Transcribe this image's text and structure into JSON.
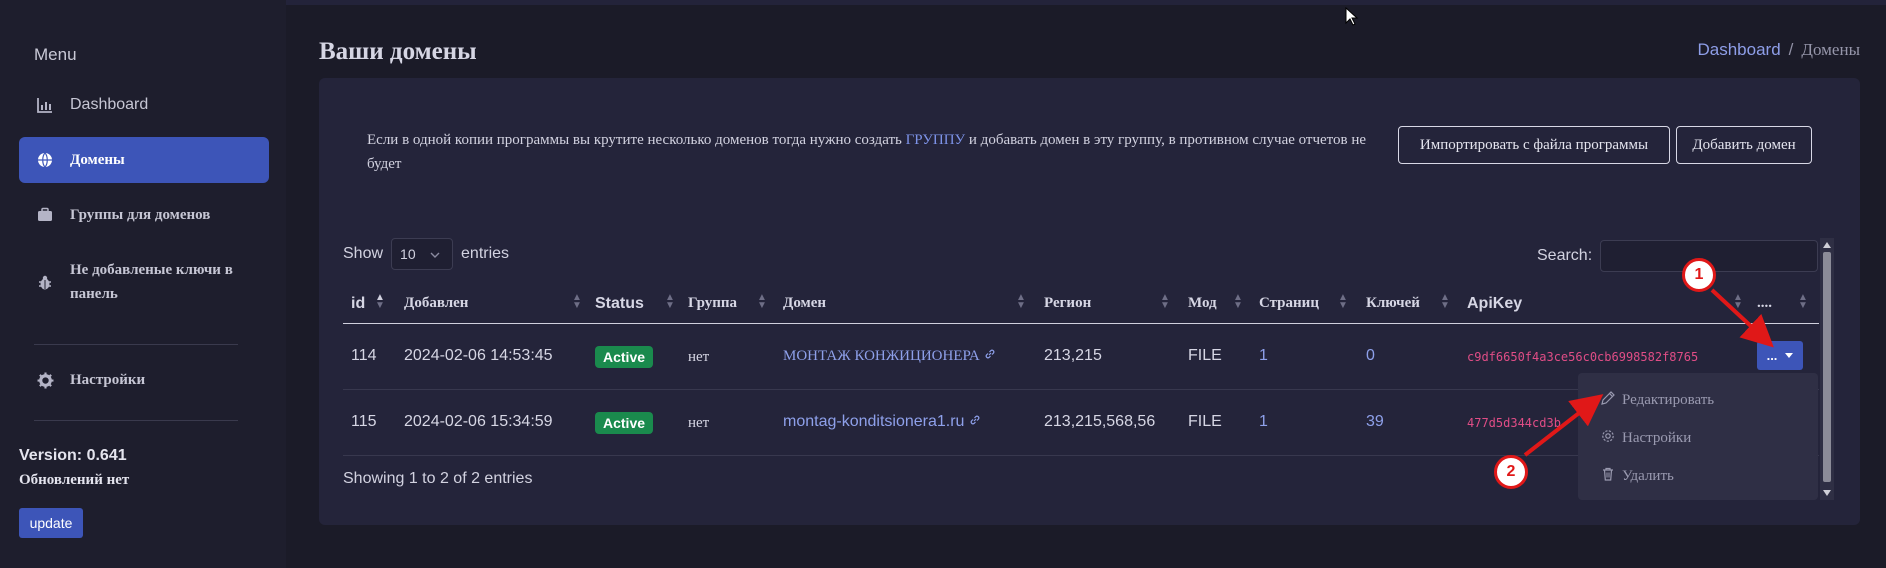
{
  "sidebar": {
    "menu_title": "Menu",
    "items": [
      {
        "label": "Dashboard",
        "icon": "chart-icon"
      },
      {
        "label": "Домены",
        "icon": "globe-icon"
      },
      {
        "label": "Группы для доменов",
        "icon": "briefcase-icon"
      },
      {
        "label": "Не добавленые ключи в панель",
        "icon": "bug-icon"
      },
      {
        "label": "Настройки",
        "icon": "gear-icon"
      }
    ],
    "version": "Version: 0.641",
    "updates_status": "Обновлений нет",
    "update_button": "update"
  },
  "header": {
    "title": "Ваши домены",
    "breadcrumb": {
      "home": "Dashboard",
      "separator": "/",
      "current": "Домены"
    }
  },
  "notice": {
    "text_before": "Если в одной копии программы вы крутите несколько доменов тогда нужно создать",
    "link": "ГРУППУ",
    "text_after": "и добавать домен в эту группу, в противном случае отчетов не будет"
  },
  "buttons": {
    "import": "Импортировать с файла программы",
    "add": "Добавить домен"
  },
  "table_controls": {
    "show_label": "Show",
    "page_size": "10",
    "entries_label": "entries",
    "search_label": "Search:",
    "search_value": "",
    "info": "Showing 1 to 2 of 2 entries"
  },
  "table": {
    "columns": [
      "id",
      "Добавлен",
      "Status",
      "Группа",
      "Домен",
      "Регион",
      "Мод",
      "Страниц",
      "Ключей",
      "ApiKey",
      "...."
    ],
    "rows": [
      {
        "id": "114",
        "added": "2024-02-06 14:53:45",
        "status": "Active",
        "group": "нет",
        "domain": "МОНТАЖ КОНЖИЦИОНЕРА",
        "region": "213,215",
        "mod": "FILE",
        "pages": "1",
        "keys": "0",
        "apikey": "c9df6650f4a3ce56c0cb6998582f8765"
      },
      {
        "id": "115",
        "added": "2024-02-06 15:34:59",
        "status": "Active",
        "group": "нет",
        "domain": "montag-konditsionera1.ru",
        "region": "213,215,568,56",
        "mod": "FILE",
        "pages": "1",
        "keys": "39",
        "apikey": "477d5d344cd3b"
      }
    ]
  },
  "row_actions": {
    "button_label": "...",
    "menu": [
      {
        "label": "Редактировать",
        "icon": "pencil-icon"
      },
      {
        "label": "Настройки",
        "icon": "gear-icon"
      },
      {
        "label": "Удалить",
        "icon": "trash-icon"
      }
    ]
  },
  "annotations": {
    "marker_1": "1",
    "marker_2": "2",
    "color": "#e01818"
  },
  "colors": {
    "accent": "#3d55b8",
    "active_badge": "#1a8a4d",
    "apikey": "#e04d86",
    "background": "#1b1b28",
    "card": "#24243a"
  }
}
